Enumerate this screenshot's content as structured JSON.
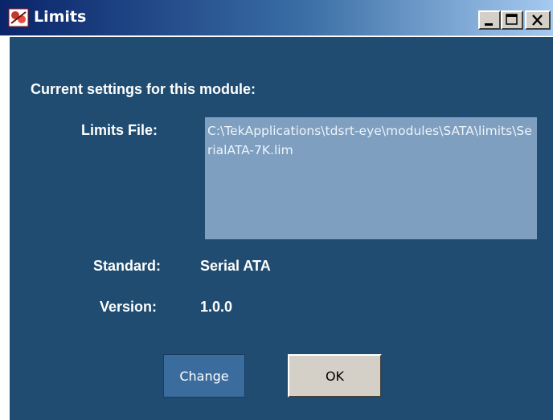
{
  "window": {
    "title": "Limits",
    "colors": {
      "titlebar_start": "#0a246a",
      "panel": "#1f4c70",
      "file_box": "#7e9fc0"
    }
  },
  "main": {
    "heading": "Current settings for this module:",
    "limits_file_label": "Limits File:",
    "limits_file_value": "C:\\TekApplications\\tdsrt-eye\\modules\\SATA\\limits\\SerialATA-7K.lim",
    "standard_label": "Standard:",
    "standard_value": "Serial ATA",
    "version_label": "Version:",
    "version_value": "1.0.0"
  },
  "buttons": {
    "change_label": "Change",
    "ok_label": "OK"
  },
  "icons": [
    "app-icon",
    "minimize-icon",
    "maximize-icon",
    "close-icon"
  ]
}
